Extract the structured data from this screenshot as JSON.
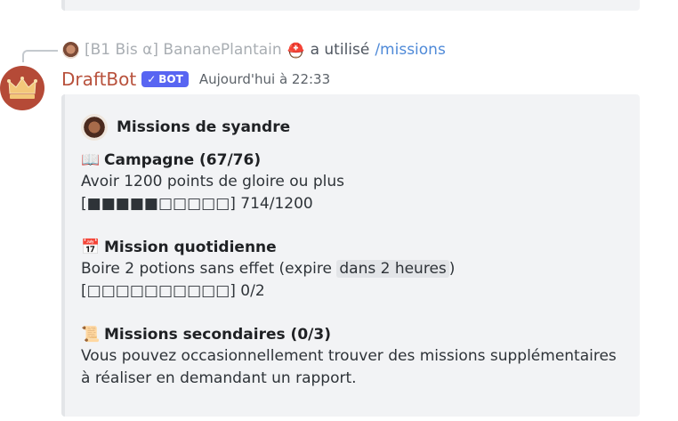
{
  "reply": {
    "name": "[B1 Bis α] BananePlantain",
    "helmet": "⛑️",
    "action": "a utilisé",
    "command": "/missions"
  },
  "author": {
    "username": "DraftBot",
    "bot_tag": "BOT",
    "bot_check": "✓",
    "timestamp": "Aujourd'hui à 22:33"
  },
  "embed": {
    "title": "Missions de syandre",
    "fields": [
      {
        "icon": "📖",
        "title": "Campagne (67/76)",
        "line1": "Avoir 1200 points de gloire ou plus",
        "line2": "[■■■■■□□□□□] 714/1200"
      },
      {
        "icon": "📅",
        "title": "Mission quotidienne",
        "line1_prefix": "Boire 2 potions sans effet (expire ",
        "line1_chip": "dans 2 heures",
        "line1_suffix": ")",
        "line2": "[□□□□□□□□□□] 0/2"
      },
      {
        "icon": "📜",
        "title": "Missions secondaires (0/3)",
        "line1": "Vous pouvez occasionnellement trouver des missions supplémentaires à réaliser en demandant un rapport."
      }
    ]
  },
  "colors": {
    "username": "#b8513c",
    "bot_badge": "#5865f2",
    "command": "#4f8ad8",
    "embed_bg": "#f2f3f5"
  }
}
